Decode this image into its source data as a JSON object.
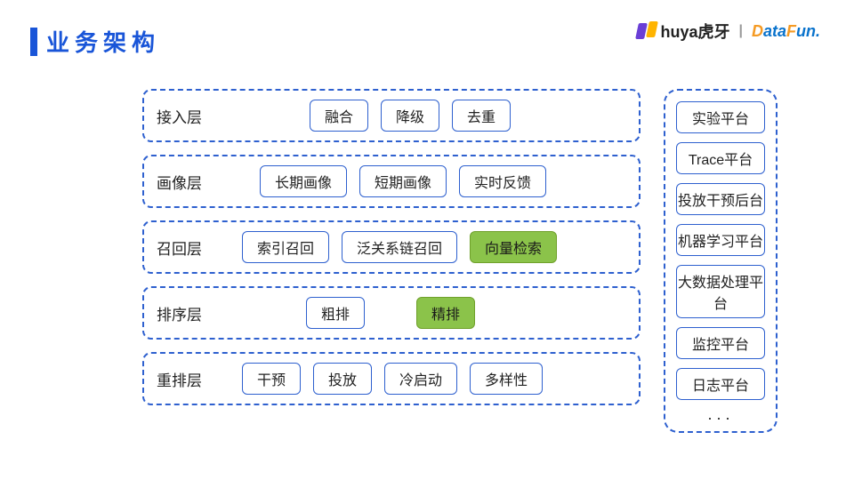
{
  "title": "业务架构",
  "brand": {
    "huya": "huya虎牙",
    "datafun_d": "D",
    "datafun_ata": "ata",
    "datafun_f": "F",
    "datafun_un": "un.",
    "sep": "|"
  },
  "layers": [
    {
      "label": "接入层",
      "items": [
        {
          "t": "融合"
        },
        {
          "t": "降级"
        },
        {
          "t": "去重"
        }
      ],
      "off": "offset1"
    },
    {
      "label": "画像层",
      "items": [
        {
          "t": "长期画像"
        },
        {
          "t": "短期画像"
        },
        {
          "t": "实时反馈"
        }
      ],
      "off": "offset2"
    },
    {
      "label": "召回层",
      "items": [
        {
          "t": "索引召回"
        },
        {
          "t": "泛关系链召回"
        },
        {
          "t": "向量检索",
          "hl": true
        }
      ],
      "off": "offset3"
    },
    {
      "label": "排序层",
      "items": [
        {
          "t": "粗排"
        },
        {
          "t": "精排",
          "hl": true
        }
      ],
      "off": "offset4"
    },
    {
      "label": "重排层",
      "items": [
        {
          "t": "干预"
        },
        {
          "t": "投放"
        },
        {
          "t": "冷启动"
        },
        {
          "t": "多样性"
        }
      ],
      "off": "offset3"
    }
  ],
  "sidebar": [
    "实验平台",
    "Trace平台",
    "投放干预后台",
    "机器学习平台",
    "大数据处理平台",
    "监控平台",
    "日志平台"
  ],
  "sidebar_more": "···"
}
